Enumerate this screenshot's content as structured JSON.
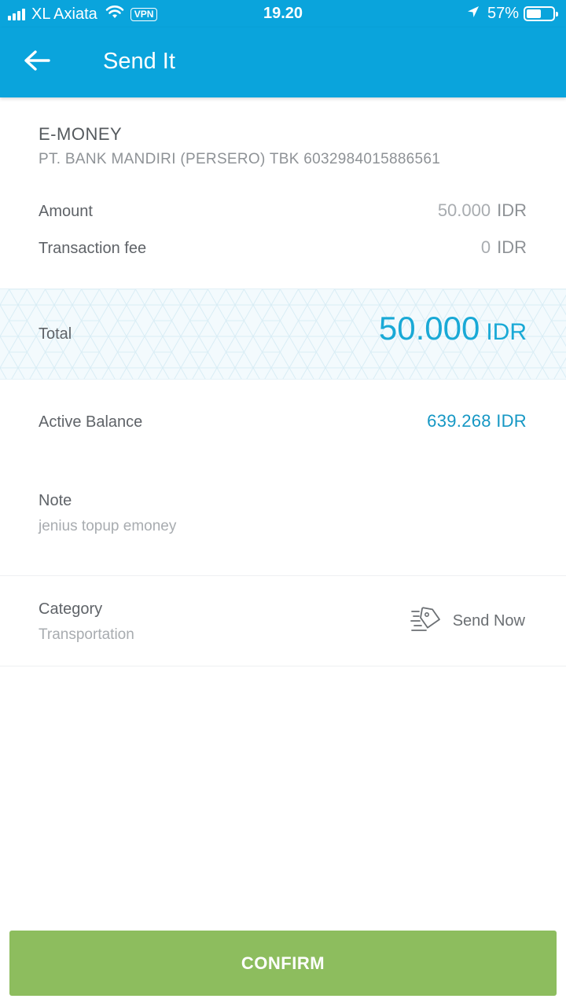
{
  "status_bar": {
    "carrier": "XL Axiata",
    "vpn": "VPN",
    "time": "19.20",
    "battery_percent": "57%",
    "battery_level": 0.57,
    "icons": [
      "signal-icon",
      "wifi-icon",
      "location-arrow-icon",
      "battery-icon"
    ]
  },
  "app_bar": {
    "title": "Send It",
    "back_icon": "arrow-left-icon",
    "background": "#0aa4dc"
  },
  "recipient": {
    "type": "E-MONEY",
    "detail": "PT. BANK MANDIRI (PERSERO) TBK 6032984015886561"
  },
  "amount": {
    "label": "Amount",
    "value": "50.000",
    "currency": "IDR"
  },
  "fee": {
    "label": "Transaction fee",
    "value": "0",
    "currency": "IDR"
  },
  "total": {
    "label": "Total",
    "value": "50.000",
    "currency": "IDR"
  },
  "balance": {
    "label": "Active Balance",
    "value": "639.268 IDR"
  },
  "note": {
    "label": "Note",
    "value": "jenius topup emoney"
  },
  "category": {
    "label": "Category",
    "value": "Transportation"
  },
  "send_now": {
    "label": "Send Now",
    "icon": "tag-send-icon"
  },
  "confirm": {
    "label": "CONFIRM",
    "color": "#8dbd5e"
  }
}
